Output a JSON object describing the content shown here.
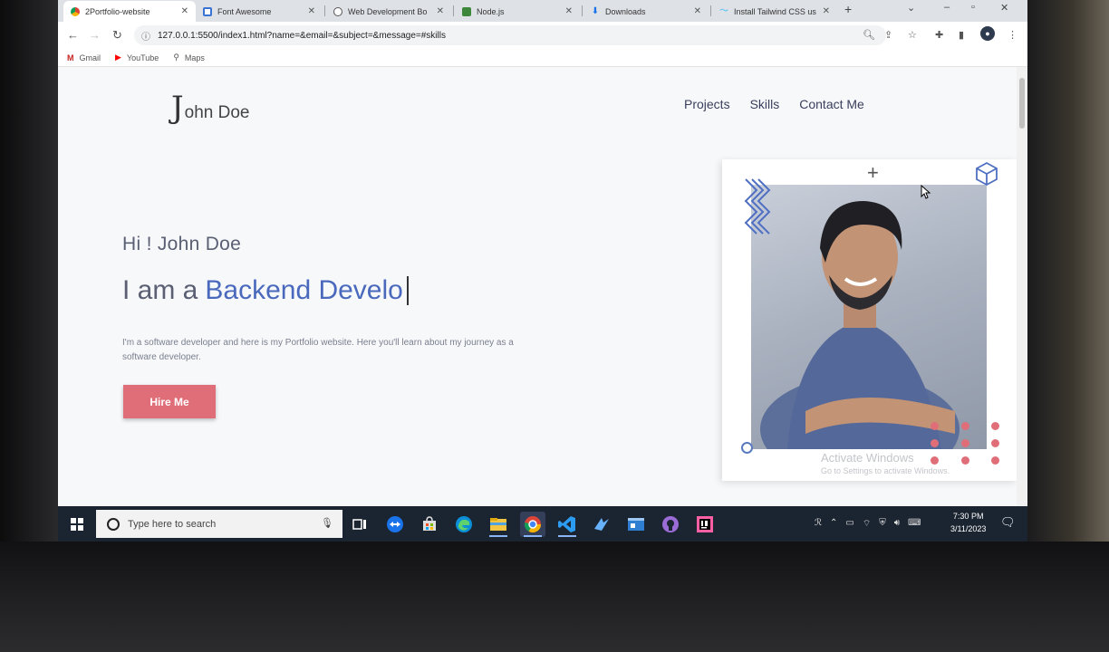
{
  "browser": {
    "tabs": [
      {
        "title": "2Portfolio-website",
        "icon": "chrome-icon",
        "active": true
      },
      {
        "title": "Font Awesome",
        "icon": "font-awesome-icon",
        "active": false
      },
      {
        "title": "Web Development Bo",
        "icon": "web-dev-icon",
        "active": false
      },
      {
        "title": "Node.js",
        "icon": "nodejs-icon",
        "active": false
      },
      {
        "title": "Downloads",
        "icon": "download-icon",
        "active": false
      },
      {
        "title": "Install Tailwind CSS us",
        "icon": "tailwind-icon",
        "active": false
      }
    ],
    "url": "127.0.0.1:5500/index1.html?name=&email=&subject=&message=#skills",
    "bookmarks": [
      {
        "label": "Gmail",
        "icon": "gmail-icon",
        "color": "#c5221f"
      },
      {
        "label": "YouTube",
        "icon": "youtube-icon",
        "color": "#ff0000"
      },
      {
        "label": "Maps",
        "icon": "maps-pin-icon",
        "color": "#555555"
      }
    ]
  },
  "site": {
    "logo_initial": "J",
    "logo_rest": "ohn Doe",
    "nav": [
      "Projects",
      "Skills",
      "Contact Me"
    ],
    "greeting": "Hi ! John Doe",
    "role_prefix": "I am a",
    "role_typed": "Backend Develo",
    "description": "I'm a software developer and here is my Portfolio website. Here you'll learn about my journey as a software developer.",
    "cta": "Hire Me",
    "accent": "#e06e78",
    "role_color": "#4a69bd"
  },
  "watermark": {
    "line1": "Activate Windows",
    "line2": "Go to Settings to activate Windows."
  },
  "taskbar": {
    "search_placeholder": "Type here to search",
    "time": "7:30 PM",
    "date": "3/11/2023"
  }
}
